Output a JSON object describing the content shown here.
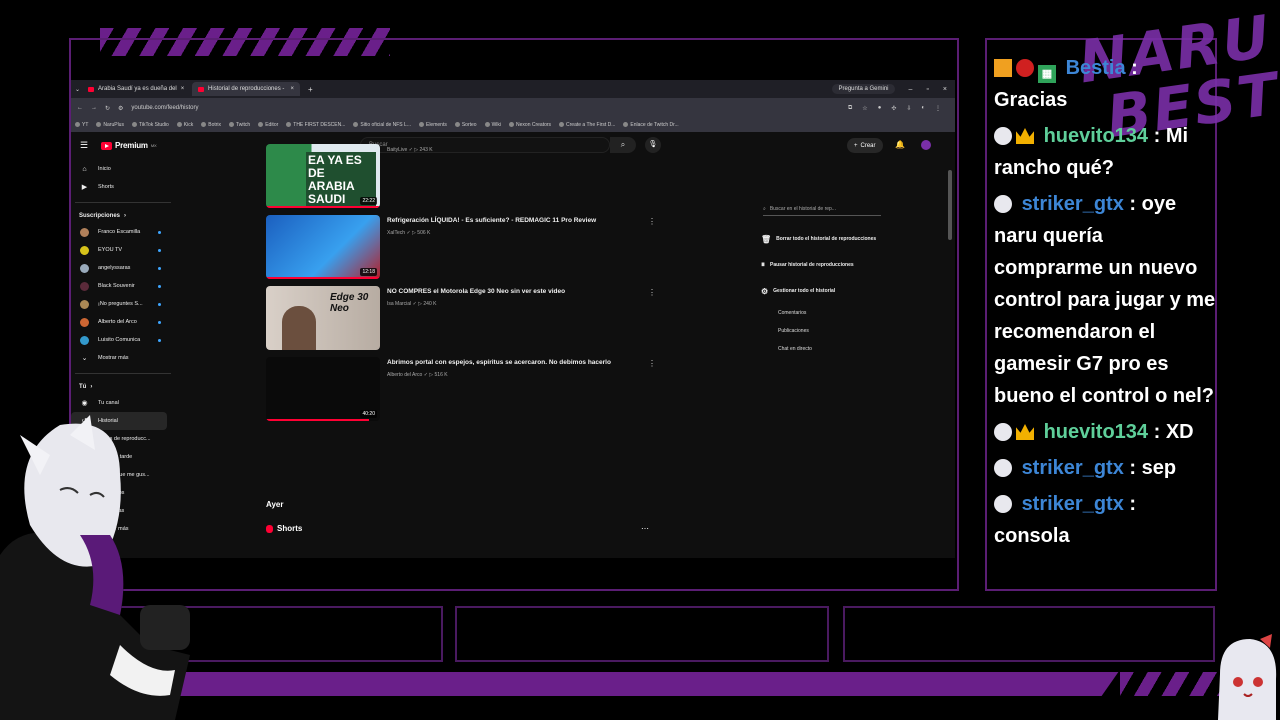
{
  "browser": {
    "tabs": [
      {
        "label": "Arabia Saudí ya es dueña del"
      },
      {
        "label": "Historial de reproducciones -"
      }
    ],
    "new_tab": "+",
    "gemini_label": "Pregunta a Gemini",
    "url": "youtube.com/feed/history",
    "bookmarks": [
      "YT",
      "NaruPlus",
      "TikTok Studio",
      "Kick",
      "Botrix",
      "Twitch",
      "Editor",
      "THE FIRST DESCEN...",
      "Sitio oficial de NFS L...",
      "Elements",
      "Sorteo",
      "Wiki",
      "Nexon Creators",
      "Create a The First D...",
      "Enlace de Twitch Dr..."
    ]
  },
  "yt": {
    "brand": "Premium",
    "brand_sup": "MX",
    "search_placeholder": "Buscar",
    "create_label": "Crear",
    "sidebar": {
      "top": [
        {
          "label": "Inicio",
          "icon": "home-icon"
        },
        {
          "label": "Shorts",
          "icon": "shorts-icon"
        }
      ],
      "subs_header": "Suscripciones",
      "subs": [
        {
          "label": "Franco Escamilla",
          "color": "#b0805a"
        },
        {
          "label": "EYOU TV",
          "color": "#d6c21a"
        },
        {
          "label": "angelyssaras",
          "color": "#9ab"
        },
        {
          "label": "Black Souvenir",
          "color": "#5a2a3a"
        },
        {
          "label": "¡No preguntes S...",
          "color": "#a85"
        },
        {
          "label": "Alberto del Arco",
          "color": "#c63"
        },
        {
          "label": "Luisito Comunica",
          "color": "#39c"
        }
      ],
      "show_more": "Mostrar más",
      "you_header": "Tú",
      "you_items": [
        {
          "label": "Tu canal",
          "active": false
        },
        {
          "label": "Historial",
          "active": true
        },
        {
          "label": "Listas de reproducc...",
          "active": false
        },
        {
          "label": "Ver más tarde",
          "active": false
        },
        {
          "label": "Videos que me gus...",
          "active": false
        },
        {
          "label": "Tus videos",
          "active": false
        },
        {
          "label": "Descargas",
          "active": false
        },
        {
          "label": "Mostrar más",
          "active": false
        }
      ]
    },
    "videos": [
      {
        "title": "",
        "channel": "BaityLive",
        "views": "243 K",
        "duration": "22:22",
        "thumb_text": "EA YA ES DE ARABIA SAUDI",
        "progress": 1.0
      },
      {
        "title": "Refrigeración LÍQUIDA! - Es suficiente? - REDMAGIC 11 Pro Review",
        "channel": "XaITech",
        "views": "506 K",
        "duration": "12:18",
        "thumb_text": "",
        "progress": 1.0
      },
      {
        "title": "NO COMPRES el Motorola Edge 30 Neo sin ver este video",
        "channel": "Isa Marcial",
        "views": "240 K",
        "duration": "",
        "thumb_text": "Edge 30 Neo",
        "progress": 0.0
      },
      {
        "title": "Abrimos portal con espejos, espíritus se acercaron. No debimos hacerlo",
        "channel": "Alberto del Arco",
        "views": "516 K",
        "duration": "40:20",
        "thumb_text": "",
        "progress": 0.9
      }
    ],
    "day_header": "Ayer",
    "shorts_label": "Shorts",
    "right_panel": {
      "search_placeholder": "Buscar en el historial de rep...",
      "actions": [
        {
          "label": "Borrar todo el historial de reproducciones",
          "icon": "trash-icon"
        },
        {
          "label": "Pausar historial de reproducciones",
          "icon": "pause-icon"
        },
        {
          "label": "Gestionar todo el historial",
          "icon": "gear-icon"
        }
      ],
      "sub_items": [
        "Comentarios",
        "Publicaciones",
        "Chat en directo"
      ]
    }
  },
  "chat": {
    "messages": [
      {
        "user": "Bestia",
        "text": ": Gracias",
        "color": "blue"
      },
      {
        "user": "huevito134",
        "text": ": Mi rancho qué?",
        "color": "green"
      },
      {
        "user": "striker_gtx",
        "text": ": oye naru quería comprarme un nuevo control para jugar y me recomendaron el gamesir G7 pro es bueno el control o nel?",
        "color": "blue"
      },
      {
        "user": "huevito134",
        "text": ": XD",
        "color": "green"
      },
      {
        "user": "striker_gtx",
        "text": ": sep",
        "color": "blue"
      },
      {
        "user": "striker_gtx",
        "text": ": consola",
        "color": "blue"
      }
    ]
  },
  "logo": {
    "line1": "NARU",
    "line2": "BESTIA"
  }
}
